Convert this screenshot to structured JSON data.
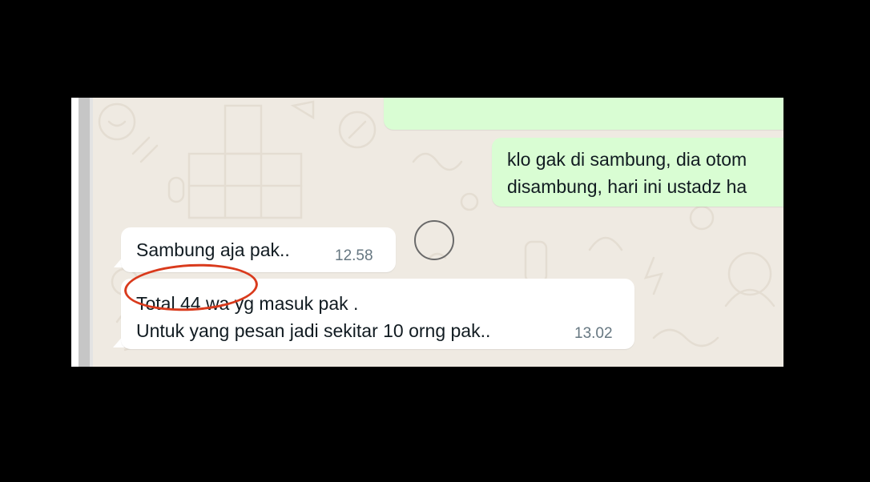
{
  "messages": {
    "outgoing_1_line1": "klo gak di sambung, dia otom",
    "outgoing_1_line2": "disambung, hari ini ustadz ha",
    "incoming_1_text": "Sambung aja pak..",
    "incoming_1_time": "12.58",
    "incoming_2_line1": "Total 44 wa yg masuk pak .",
    "incoming_2_line2": "Untuk yang pesan jadi sekitar 10 orng pak..",
    "incoming_2_time": "13.02"
  },
  "colors": {
    "outgoing_bubble": "#d9fdd3",
    "incoming_bubble": "#ffffff",
    "chat_background": "#efeae2",
    "annotation_circle": "#d93a1c"
  },
  "icons": [
    "wallpaper-doodle-pattern"
  ]
}
